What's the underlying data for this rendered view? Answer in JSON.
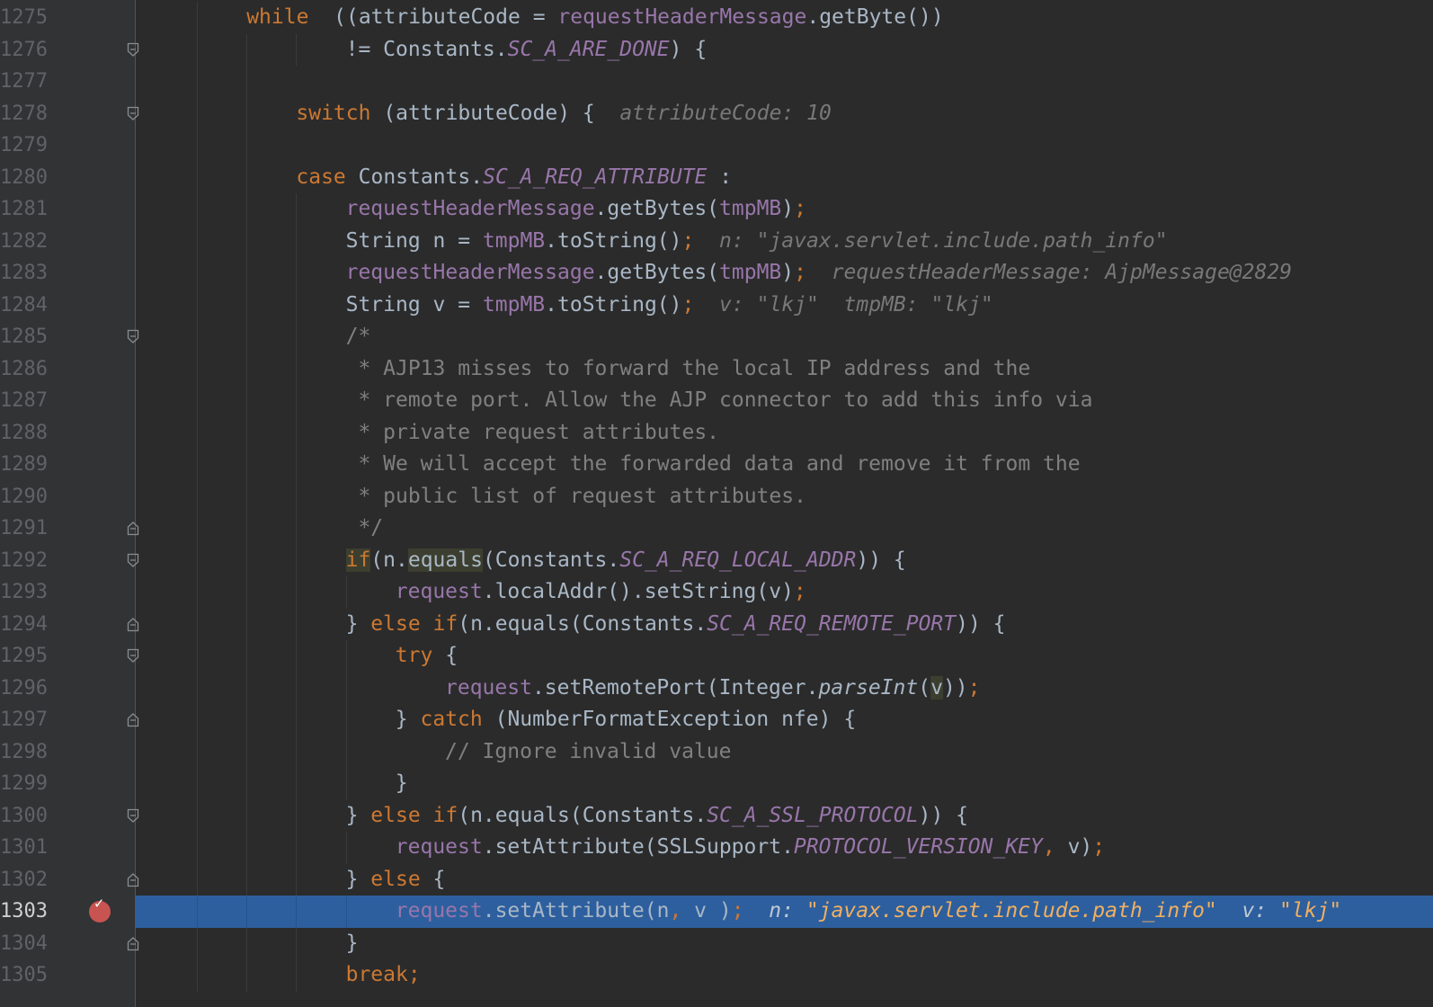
{
  "editor": {
    "current_line": "1303",
    "breakpoint_line": "1303",
    "lines": [
      {
        "num": "1275",
        "indent": "    ",
        "tokens": [
          [
            "kw",
            "while"
          ],
          [
            "",
            "  (("
          ],
          [
            "",
            "attributeCode = "
          ],
          [
            "fld",
            "requestHeaderMessage"
          ],
          [
            "",
            ".getByte())"
          ]
        ]
      },
      {
        "num": "1276",
        "indent": "            ",
        "tokens": [
          [
            "",
            "!= Constants."
          ],
          [
            "sfld",
            "SC_A_ARE_DONE"
          ],
          [
            "",
            ") {"
          ]
        ]
      },
      {
        "num": "1277",
        "indent": "",
        "tokens": []
      },
      {
        "num": "1278",
        "indent": "        ",
        "tokens": [
          [
            "kw",
            "switch"
          ],
          [
            "",
            " (attributeCode) {"
          ],
          [
            "hint",
            "  attributeCode: 10"
          ]
        ]
      },
      {
        "num": "1279",
        "indent": "",
        "tokens": []
      },
      {
        "num": "1280",
        "indent": "        ",
        "tokens": [
          [
            "kw",
            "case"
          ],
          [
            "",
            " Constants."
          ],
          [
            "sfld",
            "SC_A_REQ_ATTRIBUTE"
          ],
          [
            "",
            " :"
          ]
        ]
      },
      {
        "num": "1281",
        "indent": "            ",
        "tokens": [
          [
            "fld",
            "requestHeaderMessage"
          ],
          [
            "",
            ".getBytes("
          ],
          [
            "fld",
            "tmpMB"
          ],
          [
            "",
            ")"
          ],
          [
            "punct",
            ";"
          ]
        ]
      },
      {
        "num": "1282",
        "indent": "            ",
        "tokens": [
          [
            "",
            "String n = "
          ],
          [
            "fld",
            "tmpMB"
          ],
          [
            "",
            ".toString()"
          ],
          [
            "punct",
            ";"
          ],
          [
            "hint",
            "  n: "
          ],
          [
            "hint",
            "\"javax.servlet.include.path_info\""
          ]
        ]
      },
      {
        "num": "1283",
        "indent": "            ",
        "tokens": [
          [
            "fld",
            "requestHeaderMessage"
          ],
          [
            "",
            ".getBytes("
          ],
          [
            "fld",
            "tmpMB"
          ],
          [
            "",
            ")"
          ],
          [
            "punct",
            ";"
          ],
          [
            "hint",
            "  requestHeaderMessage: AjpMessage@2829"
          ]
        ]
      },
      {
        "num": "1284",
        "indent": "            ",
        "tokens": [
          [
            "",
            "String v = "
          ],
          [
            "fld",
            "tmpMB"
          ],
          [
            "",
            ".toString()"
          ],
          [
            "punct",
            ";"
          ],
          [
            "hint",
            "  v: \"lkj\"  tmpMB: \"lkj\""
          ]
        ]
      },
      {
        "num": "1285",
        "indent": "            ",
        "tokens": [
          [
            "cmt",
            "/*"
          ]
        ]
      },
      {
        "num": "1286",
        "indent": "            ",
        "tokens": [
          [
            "cmt",
            " * AJP13 misses to forward the local IP address and the"
          ]
        ]
      },
      {
        "num": "1287",
        "indent": "            ",
        "tokens": [
          [
            "cmt",
            " * remote port. Allow the AJP connector to add this info via"
          ]
        ]
      },
      {
        "num": "1288",
        "indent": "            ",
        "tokens": [
          [
            "cmt",
            " * private request attributes."
          ]
        ]
      },
      {
        "num": "1289",
        "indent": "            ",
        "tokens": [
          [
            "cmt",
            " * We will accept the forwarded data and remove it from the"
          ]
        ]
      },
      {
        "num": "1290",
        "indent": "            ",
        "tokens": [
          [
            "cmt",
            " * public list of request attributes."
          ]
        ]
      },
      {
        "num": "1291",
        "indent": "            ",
        "tokens": [
          [
            "cmt",
            " */"
          ]
        ]
      },
      {
        "num": "1292",
        "indent": "            ",
        "tokens": [
          [
            "kw hl",
            "if"
          ],
          [
            "",
            "(n."
          ],
          [
            "hl",
            "equals"
          ],
          [
            "",
            "(Constants."
          ],
          [
            "sfld",
            "SC_A_REQ_LOCAL_ADDR"
          ],
          [
            "",
            ")) {"
          ]
        ]
      },
      {
        "num": "1293",
        "indent": "                ",
        "tokens": [
          [
            "fld",
            "request"
          ],
          [
            "",
            ".localAddr().setString(v)"
          ],
          [
            "punct",
            ";"
          ]
        ]
      },
      {
        "num": "1294",
        "indent": "            ",
        "tokens": [
          [
            "",
            "} "
          ],
          [
            "kw",
            "else if"
          ],
          [
            "",
            "(n.equals(Constants."
          ],
          [
            "sfld",
            "SC_A_REQ_REMOTE_PORT"
          ],
          [
            "",
            ")) {"
          ]
        ]
      },
      {
        "num": "1295",
        "indent": "                ",
        "tokens": [
          [
            "kw",
            "try"
          ],
          [
            "",
            " {"
          ]
        ]
      },
      {
        "num": "1296",
        "indent": "                    ",
        "tokens": [
          [
            "fld",
            "request"
          ],
          [
            "",
            ".setRemotePort(Integer."
          ],
          [
            "smeth",
            "parseInt"
          ],
          [
            "",
            "("
          ],
          [
            "hl",
            "v"
          ],
          [
            "",
            "))"
          ],
          [
            "punct",
            ";"
          ]
        ]
      },
      {
        "num": "1297",
        "indent": "                ",
        "tokens": [
          [
            "",
            "} "
          ],
          [
            "kw",
            "catch"
          ],
          [
            "",
            " (NumberFormatException nfe) {"
          ]
        ]
      },
      {
        "num": "1298",
        "indent": "                    ",
        "tokens": [
          [
            "cmt",
            "// Ignore invalid value"
          ]
        ]
      },
      {
        "num": "1299",
        "indent": "                ",
        "tokens": [
          [
            "",
            "}"
          ]
        ]
      },
      {
        "num": "1300",
        "indent": "            ",
        "tokens": [
          [
            "",
            "} "
          ],
          [
            "kw",
            "else if"
          ],
          [
            "",
            "(n.equals(Constants."
          ],
          [
            "sfld",
            "SC_A_SSL_PROTOCOL"
          ],
          [
            "",
            ")) {"
          ]
        ]
      },
      {
        "num": "1301",
        "indent": "                ",
        "tokens": [
          [
            "fld",
            "request"
          ],
          [
            "",
            ".setAttribute(SSLSupport."
          ],
          [
            "sfld",
            "PROTOCOL_VERSION_KEY"
          ],
          [
            "punct",
            ","
          ],
          [
            "",
            " v)"
          ],
          [
            "punct",
            ";"
          ]
        ]
      },
      {
        "num": "1302",
        "indent": "            ",
        "tokens": [
          [
            "",
            "} "
          ],
          [
            "kw",
            "else"
          ],
          [
            "",
            " {"
          ]
        ]
      },
      {
        "num": "1303",
        "indent": "                ",
        "tokens": [
          [
            "fld",
            "request"
          ],
          [
            "",
            ".setAttribute(n"
          ],
          [
            "punct",
            ","
          ],
          [
            "",
            " v )"
          ],
          [
            "punct",
            ";"
          ],
          [
            "hint",
            "  n: "
          ],
          [
            "hint-str",
            "\"javax.servlet.include.path_info\""
          ],
          [
            "hint",
            "  v: "
          ],
          [
            "hint-str",
            "\"lkj\""
          ]
        ]
      },
      {
        "num": "1304",
        "indent": "            ",
        "tokens": [
          [
            "",
            "}"
          ]
        ]
      },
      {
        "num": "1305",
        "indent": "            ",
        "tokens": [
          [
            "kw",
            "break"
          ],
          [
            "punct",
            ";"
          ]
        ]
      }
    ]
  },
  "colors": {
    "background": "#2b2b2b",
    "gutter": "#313335",
    "current_line": "#2d5f9e",
    "keyword": "#cc7832",
    "field": "#9876aa",
    "comment": "#808080",
    "breakpoint": "#c75450"
  },
  "icons": {
    "fold_open": "fold-open-icon",
    "fold_close": "fold-close-icon",
    "breakpoint": "breakpoint-icon"
  }
}
